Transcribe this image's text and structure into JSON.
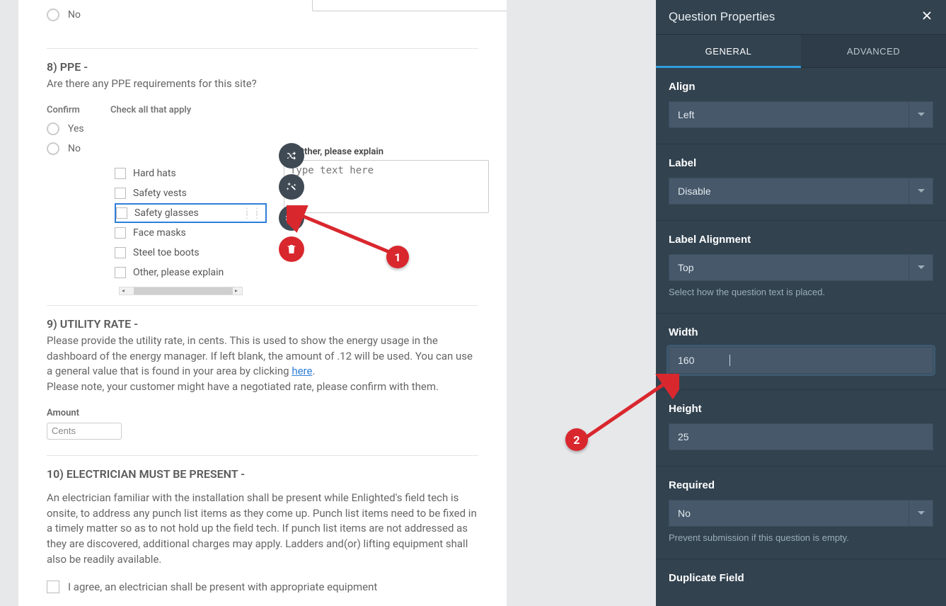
{
  "form": {
    "no_option": "No",
    "q8": {
      "title": "8) PPE -",
      "desc": "Are there any PPE requirements for this site?",
      "confirm_head": "Confirm",
      "check_head": "Check all that apply",
      "yes": "Yes",
      "no": "No",
      "options": [
        "Hard hats",
        "Safety vests",
        "Safety glasses",
        "Face masks",
        "Steel toe boots",
        "Other, please explain"
      ],
      "other_label": "Other, please explain",
      "other_placeholder": "Type text here"
    },
    "q9": {
      "title": "9) UTILITY RATE -",
      "desc_part1": "Please provide the utility rate, in cents. This is used to show the energy usage in the dashboard of the energy manager. If left blank, the amount of .12 will be used. You can use a general value that is found in your area by clicking ",
      "here": "here",
      "desc_part2": ".",
      "desc_part3": "Please note, your customer might have a negotiated rate, please confirm with them.",
      "amount_label": "Amount",
      "amount_value": "Cents"
    },
    "q10": {
      "title": "10) ELECTRICIAN MUST BE PRESENT -",
      "desc": "An electrician familiar with the installation shall be present while Enlighted's field tech is onsite, to address any punch list items as they come up. Punch list items need to be fixed in a timely matter so as to not hold up the field tech. If punch list items are not addressed as they are discovered, additional charges may apply. Ladders and(or) lifting equipment shall also be readily available.",
      "agree": "I agree, an electrician shall be present with appropriate equipment"
    }
  },
  "annotations": {
    "b1": "1",
    "b2": "2"
  },
  "panel": {
    "title": "Question Properties",
    "tabs": {
      "general": "GENERAL",
      "advanced": "ADVANCED"
    },
    "align": {
      "label": "Align",
      "value": "Left"
    },
    "labelField": {
      "label": "Label",
      "value": "Disable"
    },
    "labelAlign": {
      "label": "Label Alignment",
      "value": "Top",
      "help": "Select how the question text is placed."
    },
    "width": {
      "label": "Width",
      "value": "160"
    },
    "height": {
      "label": "Height",
      "value": "25"
    },
    "required": {
      "label": "Required",
      "value": "No",
      "help": "Prevent submission if this question is empty."
    },
    "duplicate": {
      "label": "Duplicate Field"
    }
  }
}
